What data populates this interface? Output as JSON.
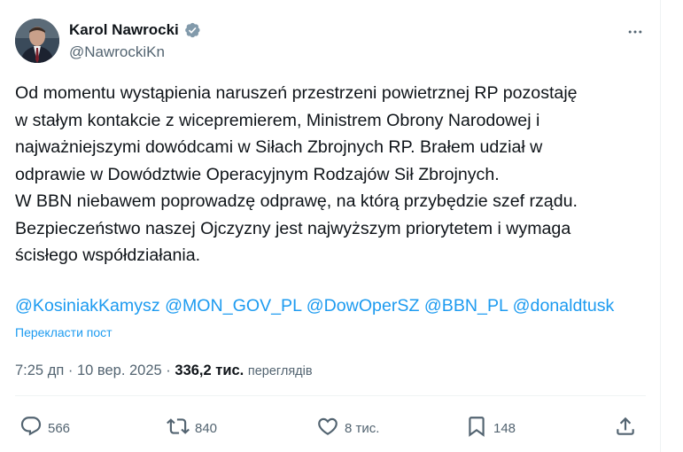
{
  "author": {
    "display_name": "Karol Nawrocki",
    "handle": "@NawrockiKn",
    "verified_color": "#829aab"
  },
  "tweet": {
    "text": "Od momentu wystąpienia naruszeń przestrzeni powietrznej RP pozostaję\nw stałym kontakcie z wicepremierem, Ministrem Obrony Narodowej i\nnajważniejszymi dowódcami w Siłach Zbrojnych RP. Brałem udział w\nodprawie w Dowództwie Operacyjnym Rodzajów Sił Zbrojnych.\nW BBN niebawem poprowadzę odprawę, na którą przybędzie szef rządu.\nBezpieczeństwo naszej Ojczyzny jest najwyższym priorytetem i wymaga\nścisłego współdziałania.",
    "mentions": [
      "@KosiniakKamysz",
      "@MON_GOV_PL",
      "@DowOperSZ",
      "@BBN_PL",
      "@donaldtusk"
    ],
    "translate_label": "Перекласти пост"
  },
  "meta": {
    "time": "7:25 дп",
    "separator": "·",
    "date": "10 вер. 2025",
    "views_count": "336,2 тис.",
    "views_label": "переглядів"
  },
  "actions": {
    "replies": "566",
    "reposts": "840",
    "likes": "8 тис.",
    "bookmarks": "148"
  },
  "colors": {
    "link": "#1d9bf0",
    "secondary_text": "#536471",
    "primary_text": "#0f1419",
    "divider": "#eff3f4"
  }
}
